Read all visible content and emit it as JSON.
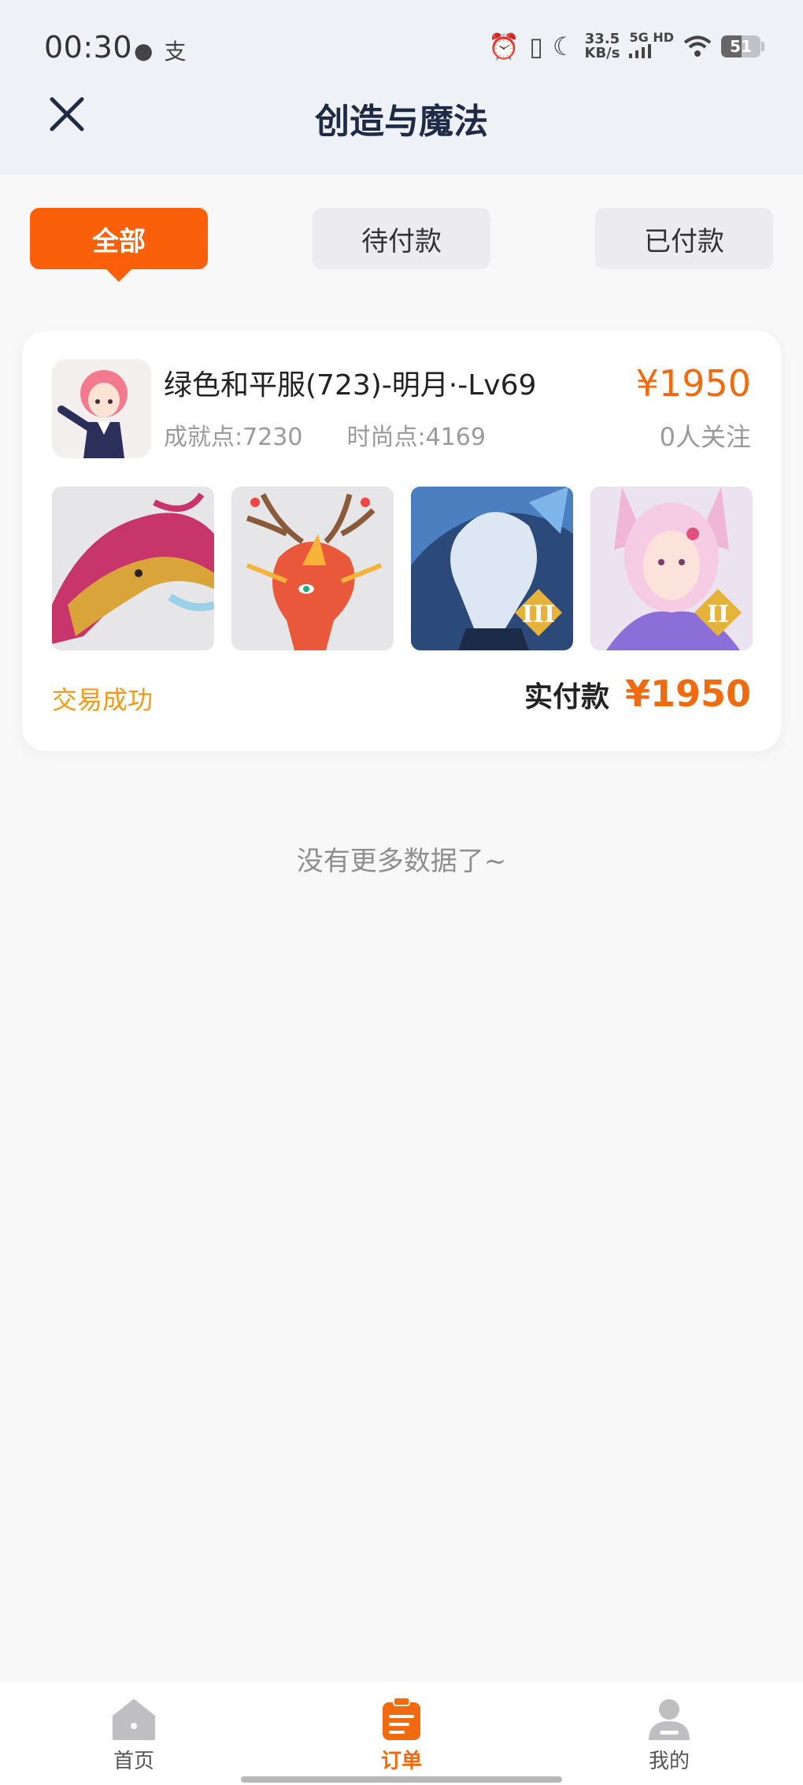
{
  "status_bar": {
    "time": "00:30",
    "speed_value": "33.5",
    "speed_unit": "KB/s",
    "network": "5G HD",
    "battery": "51"
  },
  "header": {
    "title": "创造与魔法"
  },
  "tabs": [
    {
      "label": "全部",
      "active": true
    },
    {
      "label": "待付款",
      "active": false
    },
    {
      "label": "已付款",
      "active": false
    }
  ],
  "order": {
    "title": "绿色和平服(723)-明月·-Lv69",
    "achievement": "成就点:7230",
    "fashion": "时尚点:4169",
    "price": "¥1950",
    "followers": "0人关注",
    "status": "交易成功",
    "paid_label": "实付款",
    "paid_amount": "¥1950",
    "thumbnails": [
      {
        "name": "dragon-red-gold"
      },
      {
        "name": "dragon-antler-red"
      },
      {
        "name": "ice-warrior",
        "badge": "III"
      },
      {
        "name": "fox-fairy",
        "badge": "II"
      }
    ]
  },
  "footer_note": "没有更多数据了~",
  "bottom_nav": [
    {
      "label": "首页",
      "icon": "home-icon",
      "active": false
    },
    {
      "label": "订单",
      "icon": "order-icon",
      "active": true
    },
    {
      "label": "我的",
      "icon": "user-icon",
      "active": false
    }
  ],
  "colors": {
    "accent": "#fa5f0a",
    "price": "#f06a10",
    "success": "#f09a1a"
  }
}
